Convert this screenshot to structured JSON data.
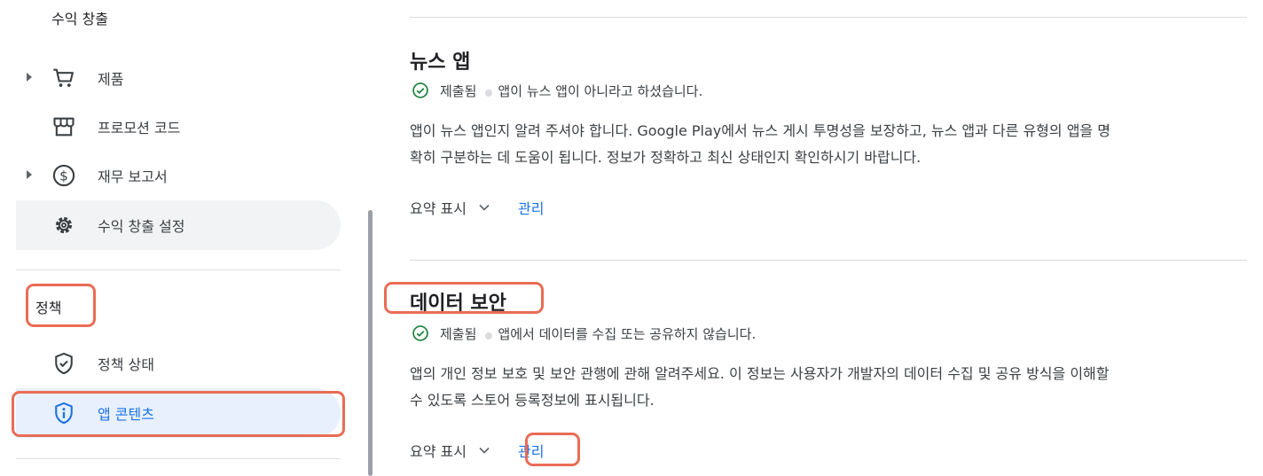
{
  "sidebar": {
    "section_title": "수익 창출",
    "items": [
      {
        "label": "제품",
        "icon": "cart-icon"
      },
      {
        "label": "프로모션 코드",
        "icon": "store-icon"
      },
      {
        "label": "재무 보고서",
        "icon": "dollar-icon"
      },
      {
        "label": "수익 창출 설정",
        "icon": "gear-icon"
      }
    ],
    "policy_header": "정책",
    "policy_items": [
      {
        "label": "정책 상태",
        "icon": "shield-check-icon"
      },
      {
        "label": "앱 콘텐츠",
        "icon": "shield-info-icon"
      }
    ]
  },
  "cards": [
    {
      "title": "뉴스 앱",
      "status": "제출됨",
      "status_detail": "앱이 뉴스 앱이 아니라고 하셨습니다.",
      "desc_line1": "앱이 뉴스 앱인지 알려 주셔야 합니다. Google Play에서 뉴스 게시 투명성을 보장하고, 뉴스 앱과 다른 유형의 앱을 명",
      "desc_line2": "확히 구분하는 데 도움이 됩니다. 정보가 정확하고 최신 상태인지 확인하시기 바랍니다.",
      "summary_label": "요약 표시",
      "manage_label": "관리"
    },
    {
      "title": "데이터 보안",
      "status": "제출됨",
      "status_detail": "앱에서 데이터를 수집 또는 공유하지 않습니다.",
      "desc_line1": "앱의 개인 정보 보호 및 보안 관행에 관해 알려주세요. 이 정보는 사용자가 개발자의 데이터 수집 및 공유 방식을 이해할",
      "desc_line2": "수 있도록 스토어 등록정보에 표시됩니다.",
      "summary_label": "요약 표시",
      "manage_label": "관리"
    }
  ],
  "colors": {
    "accent": "#1a73e8",
    "highlight": "#ea6c55",
    "success": "#188038"
  }
}
